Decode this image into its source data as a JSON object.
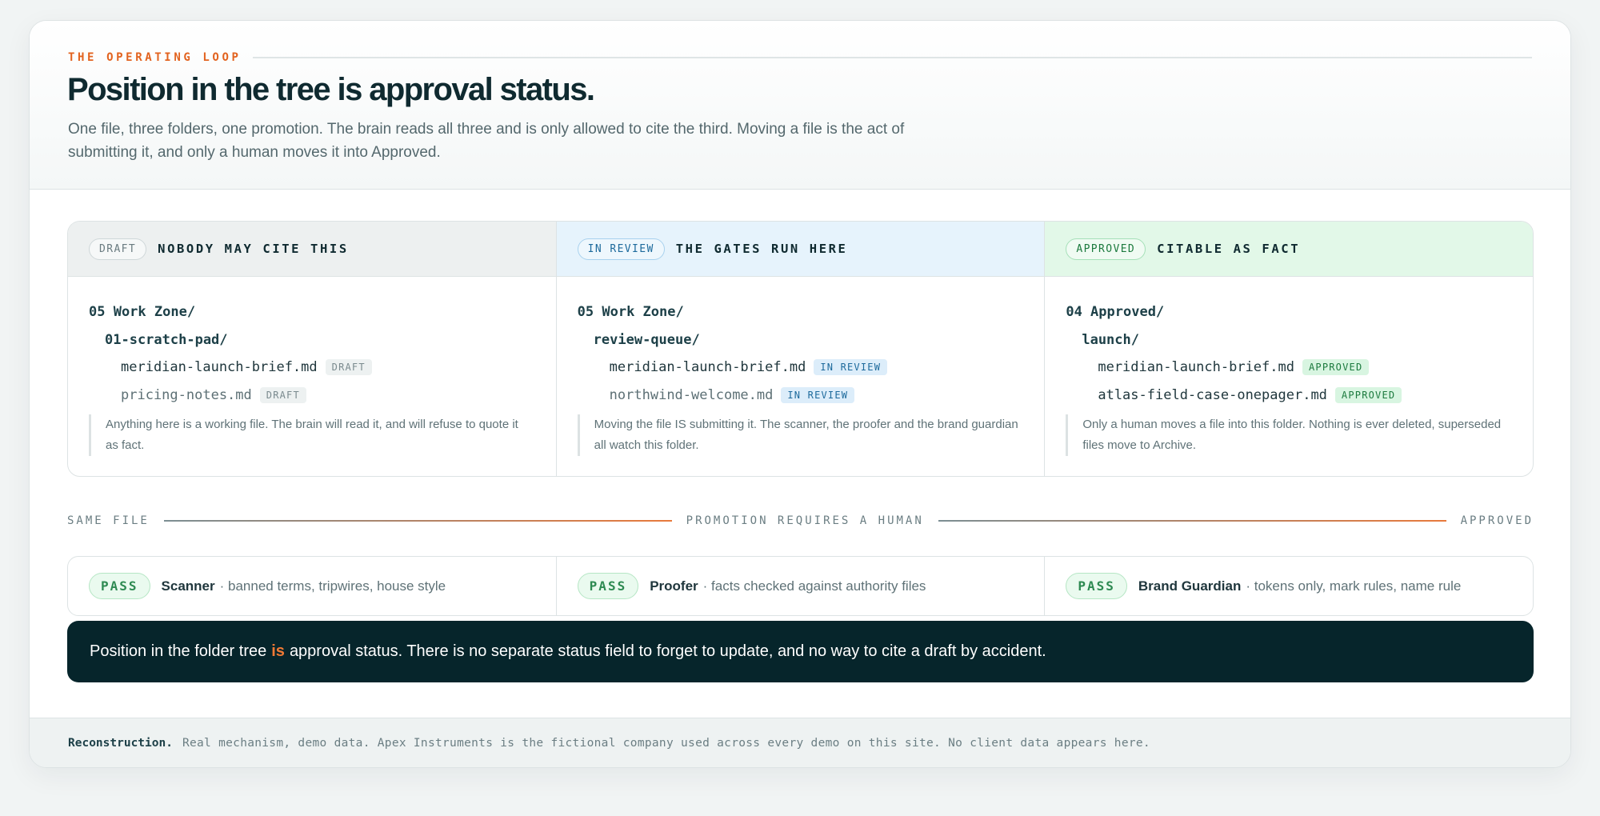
{
  "header": {
    "eyebrow": "THE OPERATING LOOP",
    "title": "Position in the tree is approval status.",
    "subtitle": "One file, three folders, one promotion. The brain reads all three and is only allowed to cite the third. Moving a file is the act of submitting it, and only a human moves it into Approved."
  },
  "columns": [
    {
      "pill": "DRAFT",
      "title": "NOBODY MAY CITE THIS",
      "root": "05 Work Zone/",
      "sub": "01-scratch-pad/",
      "files": [
        {
          "name": "meridian-launch-brief.md",
          "tag": "DRAFT"
        },
        {
          "name": "pricing-notes.md",
          "tag": "DRAFT"
        }
      ],
      "note": "Anything here is a working file. The brain will read it, and will refuse to quote it as fact."
    },
    {
      "pill": "IN REVIEW",
      "title": "THE GATES RUN HERE",
      "root": "05 Work Zone/",
      "sub": "review-queue/",
      "files": [
        {
          "name": "meridian-launch-brief.md",
          "tag": "IN REVIEW"
        },
        {
          "name": "northwind-welcome.md",
          "tag": "IN REVIEW"
        }
      ],
      "note": "Moving the file IS submitting it. The scanner, the proofer and the brand guardian all watch this folder."
    },
    {
      "pill": "APPROVED",
      "title": "CITABLE AS FACT",
      "root": "04 Approved/",
      "sub": "launch/",
      "files": [
        {
          "name": "meridian-launch-brief.md",
          "tag": "APPROVED"
        },
        {
          "name": "atlas-field-case-onepager.md",
          "tag": "APPROVED"
        }
      ],
      "note": "Only a human moves a file into this folder. Nothing is ever deleted, superseded files move to Archive."
    }
  ],
  "promotion": {
    "left": "SAME FILE",
    "center": "PROMOTION REQUIRES A HUMAN",
    "right": "APPROVED"
  },
  "gates": [
    {
      "status": "PASS",
      "name": "Scanner",
      "desc": "· banned terms, tripwires, house style"
    },
    {
      "status": "PASS",
      "name": "Proofer",
      "desc": "· facts checked against authority files"
    },
    {
      "status": "PASS",
      "name": "Brand Guardian",
      "desc": "· tokens only, mark rules, name rule"
    }
  ],
  "statement": {
    "before": "Position in the folder tree",
    "accent": "is",
    "after": "approval status. There is no separate status field to forget to update, and no way to cite a draft by accident."
  },
  "footer": {
    "strong": "Reconstruction.",
    "text": "Real mechanism, demo data. Apex Instruments is the fictional company used across every demo on this site. No client data appears here."
  },
  "colors": {
    "accent": "#e2631f",
    "ink": "#0f2a30",
    "dark_bar": "#06252b",
    "draft": "#edf0f0",
    "review": "#e6f3fc",
    "approved": "#e2f8e8",
    "pass": "#2e8a52"
  }
}
